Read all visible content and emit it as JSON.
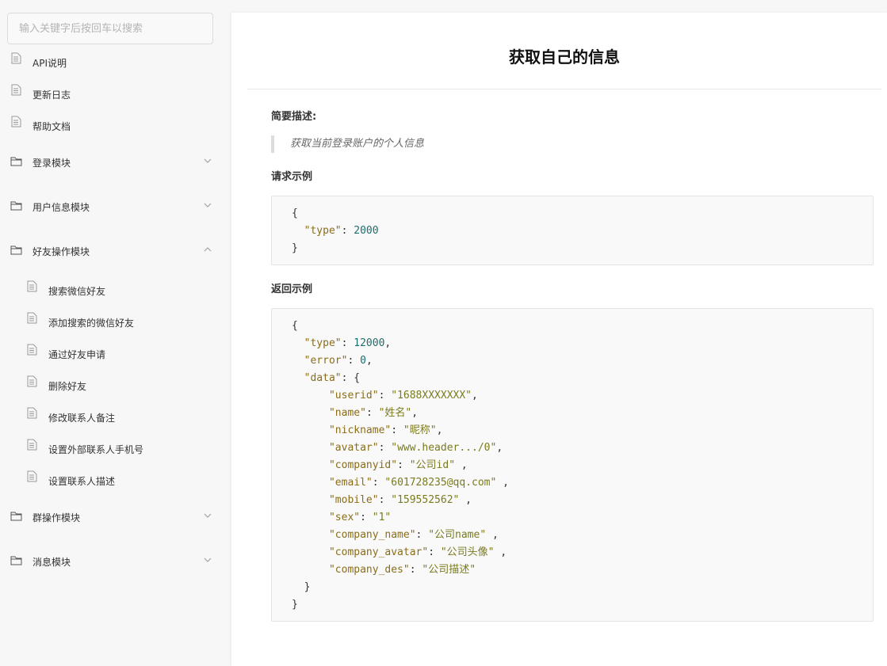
{
  "sidebar": {
    "search_placeholder": "输入关键字后按回车以搜索",
    "items": [
      {
        "label": "API说明",
        "icon": "document-icon"
      },
      {
        "label": "更新日志",
        "icon": "document-icon"
      },
      {
        "label": "帮助文档",
        "icon": "document-icon"
      },
      {
        "label": "登录模块",
        "icon": "folder-icon",
        "expanded": false
      },
      {
        "label": "用户信息模块",
        "icon": "folder-icon",
        "expanded": false
      },
      {
        "label": "好友操作模块",
        "icon": "folder-icon",
        "expanded": true
      },
      {
        "label": "搜索微信好友",
        "icon": "document-icon"
      },
      {
        "label": "添加搜索的微信好友",
        "icon": "document-icon"
      },
      {
        "label": "通过好友申请",
        "icon": "document-icon"
      },
      {
        "label": "删除好友",
        "icon": "document-icon"
      },
      {
        "label": "修改联系人备注",
        "icon": "document-icon"
      },
      {
        "label": "设置外部联系人手机号",
        "icon": "document-icon"
      },
      {
        "label": "设置联系人描述",
        "icon": "document-icon"
      },
      {
        "label": "群操作模块",
        "icon": "folder-icon",
        "expanded": false
      },
      {
        "label": "消息模块",
        "icon": "folder-icon",
        "expanded": false
      }
    ]
  },
  "main": {
    "title": "获取自己的信息",
    "summary_heading": "简要描述:",
    "summary_text": "获取当前登录账户的个人信息",
    "request_heading": "请求示例",
    "request_lines": [
      "{",
      "  \"type\": 2000",
      "}"
    ],
    "response_heading": "返回示例",
    "response_lines": [
      "{",
      "  \"type\": 12000,",
      "  \"error\": 0,",
      "  \"data\": {",
      "      \"userid\": \"1688XXXXXXX\",",
      "      \"name\": \"姓名\",",
      "      \"nickname\": \"昵称\",",
      "      \"avatar\": \"www.header.../0\",",
      "      \"companyid\": \"公司id\" ,",
      "      \"email\": \"601728235@qq.com\" ,",
      "      \"mobile\": \"159552562\" ,",
      "      \"sex\": \"1\"",
      "      \"company_name\": \"公司name\" ,",
      "      \"company_avatar\": \"公司头像\" ,",
      "      \"company_des\": \"公司描述\"",
      "  }",
      "}"
    ]
  }
}
